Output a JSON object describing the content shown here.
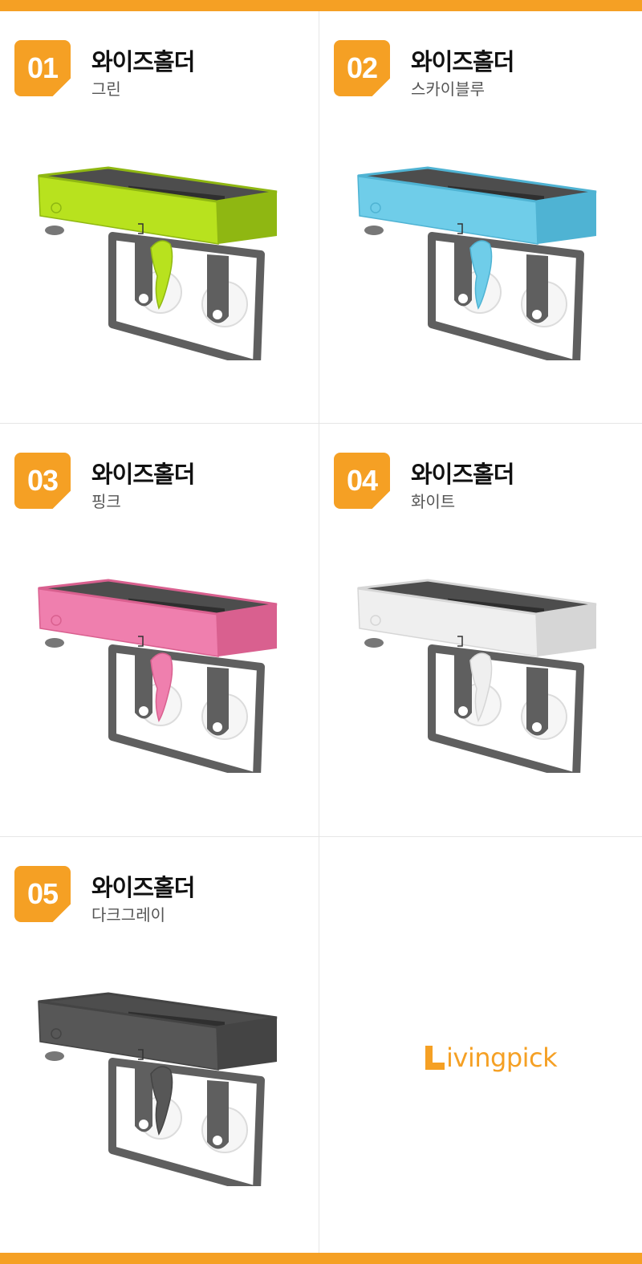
{
  "colors": {
    "accent": "#f5a024",
    "green": "#b8e21e",
    "sky_blue": "#6fcde9",
    "pink": "#ef7fae",
    "white": "#efefef",
    "dark_gray": "#575757",
    "frame": "#5f5f5f"
  },
  "items": [
    {
      "number": "01",
      "name": "와이즈홀더",
      "color_name": "그린",
      "color": "#b8e21e",
      "shade": "#8fb712",
      "product_icon": "wiseholder-green"
    },
    {
      "number": "02",
      "name": "와이즈홀더",
      "color_name": "스카이블루",
      "color": "#6fcde9",
      "shade": "#4fb3d3",
      "product_icon": "wiseholder-skyblue"
    },
    {
      "number": "03",
      "name": "와이즈홀더",
      "color_name": "핑크",
      "color": "#ef7fae",
      "shade": "#d9608f",
      "product_icon": "wiseholder-pink"
    },
    {
      "number": "04",
      "name": "와이즈홀더",
      "color_name": "화이트",
      "color": "#efefef",
      "shade": "#d6d6d6",
      "product_icon": "wiseholder-white"
    },
    {
      "number": "05",
      "name": "와이즈홀더",
      "color_name": "다크그레이",
      "color": "#575757",
      "shade": "#444444",
      "product_icon": "wiseholder-darkgray"
    }
  ],
  "brand": {
    "logo_text": "ivingpick",
    "logo_icon": "livingpick-logo"
  }
}
